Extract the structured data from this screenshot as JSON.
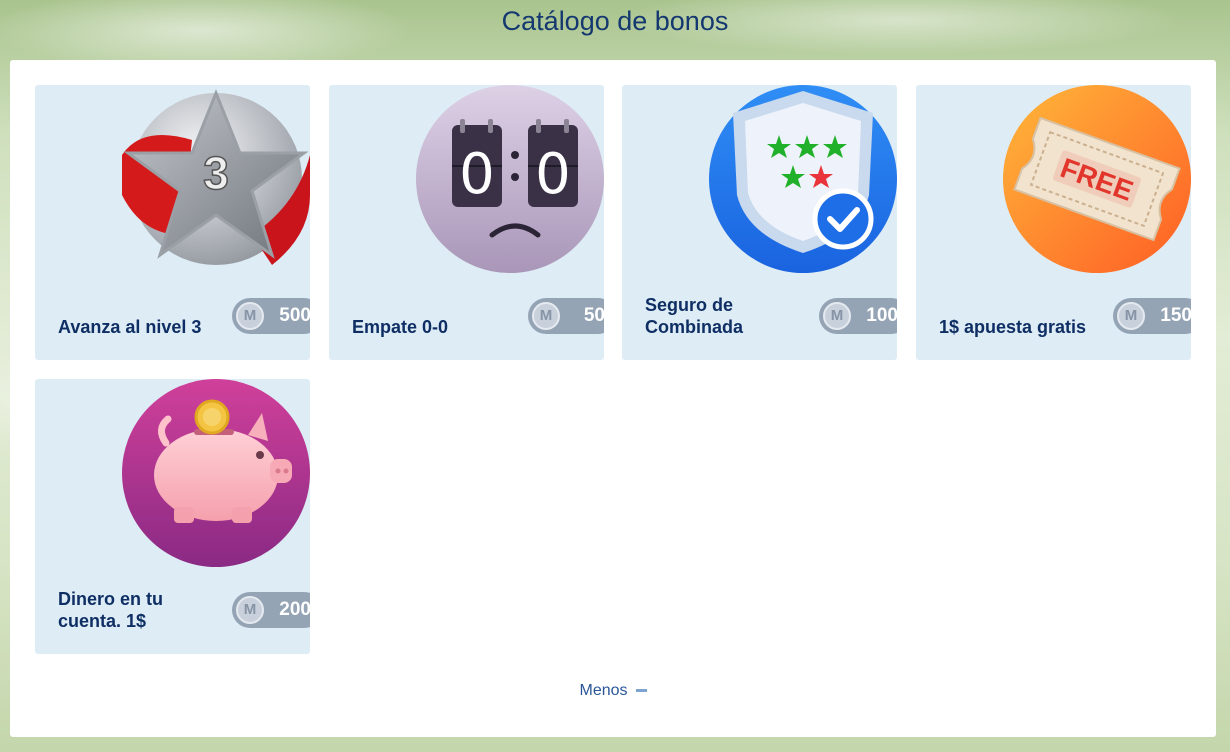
{
  "header": {
    "title": "Catálogo de bonos"
  },
  "cards": [
    {
      "label": "Avanza al nivel 3",
      "price": "500",
      "icon": "level-3-star-icon",
      "coin": "M"
    },
    {
      "label": "Empate 0-0",
      "price": "50",
      "icon": "draw-scoreboard-icon",
      "coin": "M"
    },
    {
      "label": "Seguro de Combinada",
      "price": "100",
      "icon": "insurance-shield-icon",
      "coin": "M"
    },
    {
      "label": "1$ apuesta gratis",
      "price": "150",
      "icon": "free-ticket-icon",
      "coin": "M"
    },
    {
      "label": "Dinero en tu cuenta. 1$",
      "price": "200",
      "icon": "piggy-bank-icon",
      "coin": "M"
    }
  ],
  "scoreboard": {
    "left": "0",
    "right": "0"
  },
  "level_badge": {
    "number": "3"
  },
  "ticket": {
    "text": "FREE"
  },
  "toggle": {
    "label": "Menos"
  },
  "colors": {
    "title": "#14386f",
    "card_bg": "#deecf6",
    "price_pill": "#95a4b5",
    "label": "#0f2f64"
  }
}
